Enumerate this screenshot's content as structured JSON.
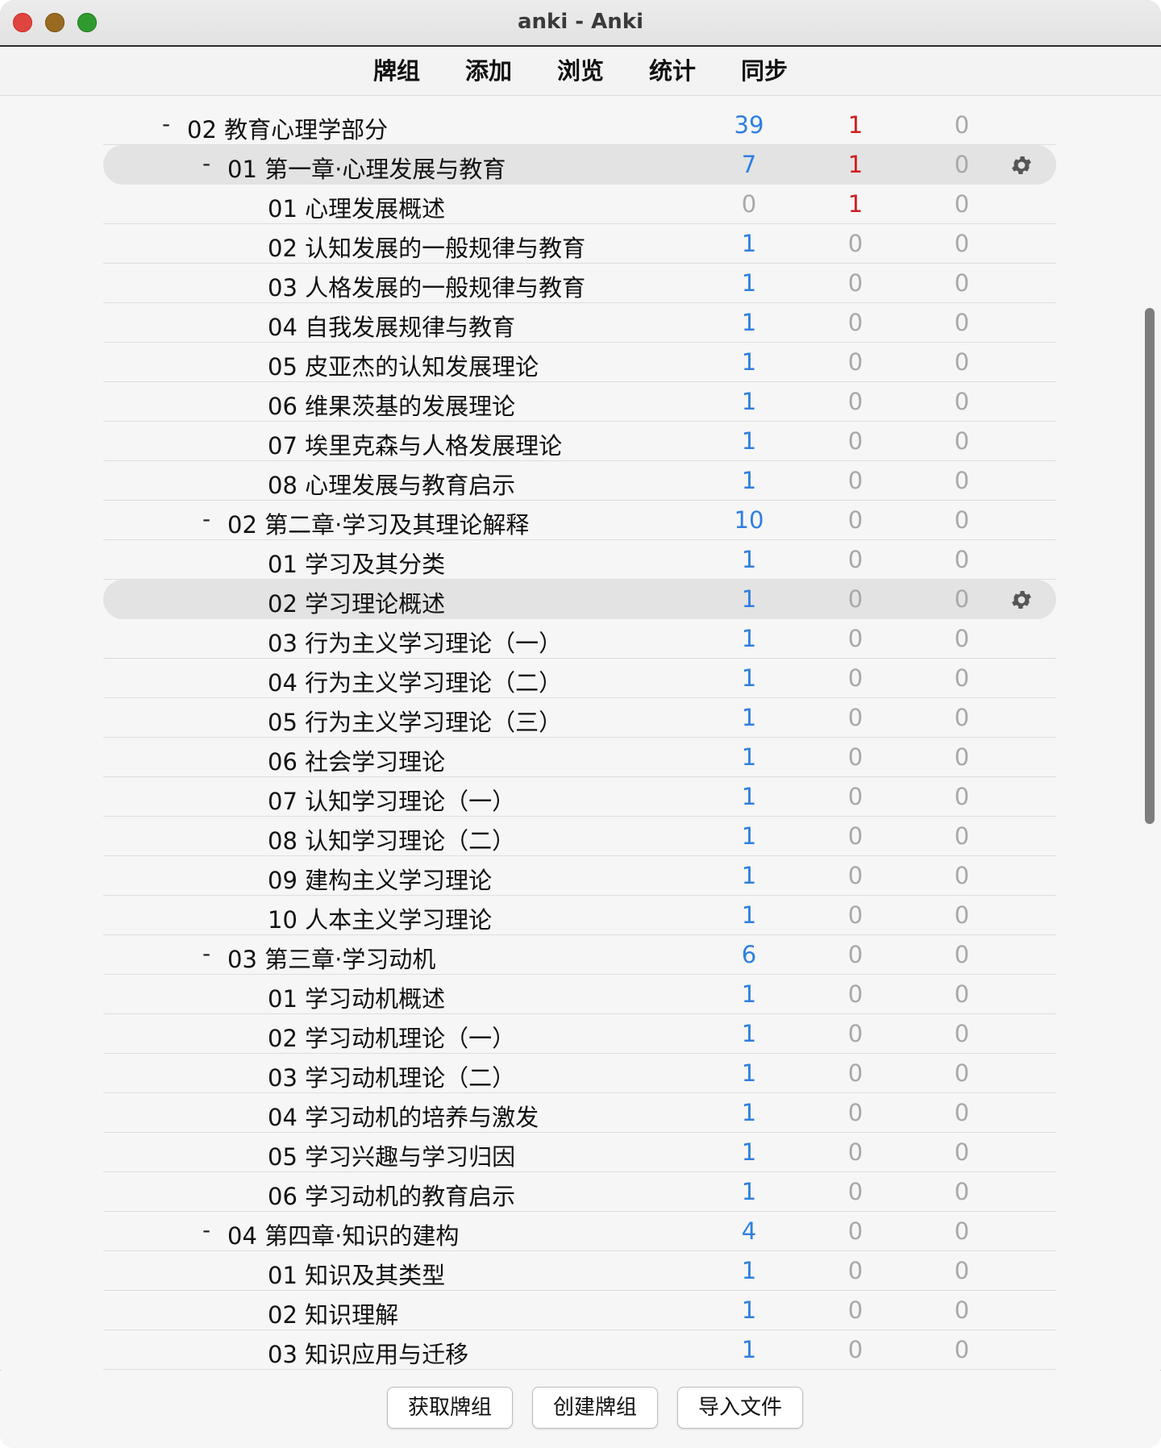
{
  "window": {
    "title": "anki - Anki"
  },
  "toolbar": {
    "items": [
      "牌组",
      "添加",
      "浏览",
      "统计",
      "同步"
    ]
  },
  "colors": {
    "new": "#2f7fdf",
    "learn": "#d01e1e",
    "zero": "#a8a8a8",
    "accent_row": "#e3e3e3"
  },
  "decks": [
    {
      "name": "02 教育心理学部分",
      "level": 1,
      "collapse": "-",
      "new": "39",
      "learn": "1",
      "due": "0"
    },
    {
      "name": "01 第一章·心理发展与教育",
      "level": 2,
      "collapse": "-",
      "new": "7",
      "learn": "1",
      "due": "0",
      "current": true
    },
    {
      "name": "01 心理发展概述",
      "level": 3,
      "new": "0",
      "learn": "1",
      "due": "0"
    },
    {
      "name": "02 认知发展的一般规律与教育",
      "level": 3,
      "new": "1",
      "learn": "0",
      "due": "0"
    },
    {
      "name": "03 人格发展的一般规律与教育",
      "level": 3,
      "new": "1",
      "learn": "0",
      "due": "0"
    },
    {
      "name": "04 自我发展规律与教育",
      "level": 3,
      "new": "1",
      "learn": "0",
      "due": "0"
    },
    {
      "name": "05 皮亚杰的认知发展理论",
      "level": 3,
      "new": "1",
      "learn": "0",
      "due": "0"
    },
    {
      "name": "06 维果茨基的发展理论",
      "level": 3,
      "new": "1",
      "learn": "0",
      "due": "0"
    },
    {
      "name": "07 埃里克森与人格发展理论",
      "level": 3,
      "new": "1",
      "learn": "0",
      "due": "0"
    },
    {
      "name": "08 心理发展与教育启示",
      "level": 3,
      "new": "1",
      "learn": "0",
      "due": "0"
    },
    {
      "name": "02 第二章·学习及其理论解释",
      "level": 2,
      "collapse": "-",
      "new": "10",
      "learn": "0",
      "due": "0"
    },
    {
      "name": "01 学习及其分类",
      "level": 3,
      "new": "1",
      "learn": "0",
      "due": "0"
    },
    {
      "name": "02 学习理论概述",
      "level": 3,
      "new": "1",
      "learn": "0",
      "due": "0",
      "current": true
    },
    {
      "name": "03 行为主义学习理论（一）",
      "level": 3,
      "new": "1",
      "learn": "0",
      "due": "0"
    },
    {
      "name": "04 行为主义学习理论（二）",
      "level": 3,
      "new": "1",
      "learn": "0",
      "due": "0"
    },
    {
      "name": "05 行为主义学习理论（三）",
      "level": 3,
      "new": "1",
      "learn": "0",
      "due": "0"
    },
    {
      "name": "06 社会学习理论",
      "level": 3,
      "new": "1",
      "learn": "0",
      "due": "0"
    },
    {
      "name": "07 认知学习理论（一）",
      "level": 3,
      "new": "1",
      "learn": "0",
      "due": "0"
    },
    {
      "name": "08 认知学习理论（二）",
      "level": 3,
      "new": "1",
      "learn": "0",
      "due": "0"
    },
    {
      "name": "09 建构主义学习理论",
      "level": 3,
      "new": "1",
      "learn": "0",
      "due": "0"
    },
    {
      "name": "10 人本主义学习理论",
      "level": 3,
      "new": "1",
      "learn": "0",
      "due": "0"
    },
    {
      "name": "03 第三章·学习动机",
      "level": 2,
      "collapse": "-",
      "new": "6",
      "learn": "0",
      "due": "0"
    },
    {
      "name": "01 学习动机概述",
      "level": 3,
      "new": "1",
      "learn": "0",
      "due": "0"
    },
    {
      "name": "02 学习动机理论（一）",
      "level": 3,
      "new": "1",
      "learn": "0",
      "due": "0"
    },
    {
      "name": "03 学习动机理论（二）",
      "level": 3,
      "new": "1",
      "learn": "0",
      "due": "0"
    },
    {
      "name": "04 学习动机的培养与激发",
      "level": 3,
      "new": "1",
      "learn": "0",
      "due": "0"
    },
    {
      "name": "05 学习兴趣与学习归因",
      "level": 3,
      "new": "1",
      "learn": "0",
      "due": "0"
    },
    {
      "name": "06 学习动机的教育启示",
      "level": 3,
      "new": "1",
      "learn": "0",
      "due": "0"
    },
    {
      "name": "04 第四章·知识的建构",
      "level": 2,
      "collapse": "-",
      "new": "4",
      "learn": "0",
      "due": "0"
    },
    {
      "name": "01 知识及其类型",
      "level": 3,
      "new": "1",
      "learn": "0",
      "due": "0"
    },
    {
      "name": "02 知识理解",
      "level": 3,
      "new": "1",
      "learn": "0",
      "due": "0"
    },
    {
      "name": "03 知识应用与迁移",
      "level": 3,
      "new": "1",
      "learn": "0",
      "due": "0"
    }
  ],
  "bottom_buttons": {
    "get_shared": "获取牌组",
    "create_deck": "创建牌组",
    "import_file": "导入文件"
  }
}
